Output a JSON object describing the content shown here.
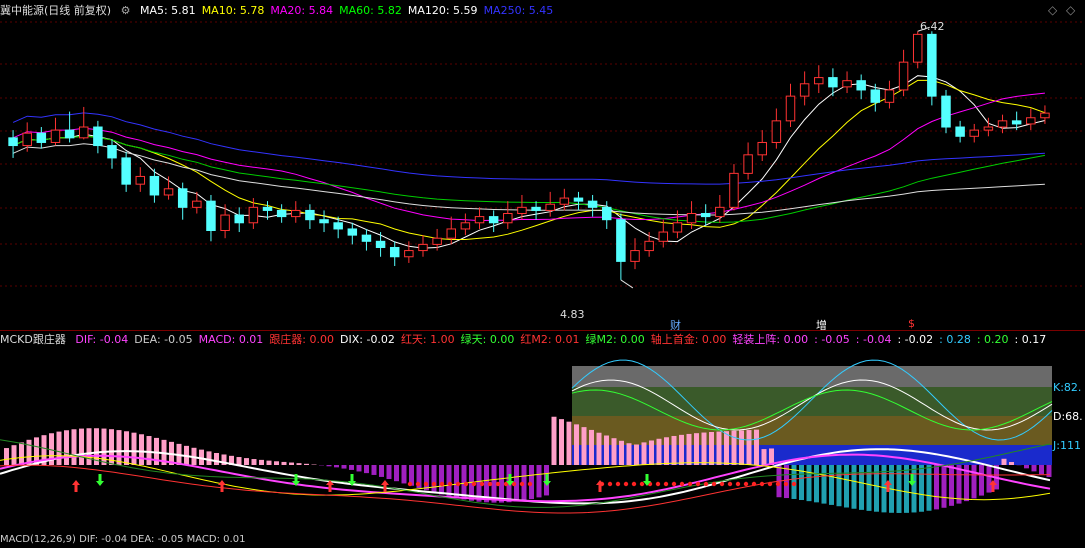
{
  "main_header": {
    "title": "冀中能源(日线 前复权)",
    "items": [
      {
        "label": "MA5: 5.81",
        "color": "#ffffff"
      },
      {
        "label": "MA10: 5.78",
        "color": "#ffff00"
      },
      {
        "label": "MA20: 5.84",
        "color": "#ff00ff"
      },
      {
        "label": "MA60: 5.82",
        "color": "#00ff00"
      },
      {
        "label": "MA120: 5.59",
        "color": "#ffffff"
      },
      {
        "label": "MA250: 5.45",
        "color": "#3333ff"
      }
    ]
  },
  "price_annotations": {
    "high": "6.42",
    "low": "4.83"
  },
  "event_markers": [
    {
      "label": "财",
      "color": "#66aaff"
    },
    {
      "label": "增",
      "color": "#ffffff"
    },
    {
      "label": "$",
      "color": "#ff3333"
    }
  ],
  "indicator_header": {
    "title": "MCKD跟庄器",
    "items": [
      {
        "label": "DIF: -0.04",
        "color": "#ff44ff"
      },
      {
        "label": "DEA: -0.05",
        "color": "#cccccc"
      },
      {
        "label": "MACD: 0.01",
        "color": "#ff44ff"
      },
      {
        "label": "跟庄器: 0.00",
        "color": "#ff3333"
      },
      {
        "label": "DIX: -0.02",
        "color": "#ffffff"
      },
      {
        "label": "红天: 1.00",
        "color": "#ff3333"
      },
      {
        "label": "绿天: 0.00",
        "color": "#33ff33"
      },
      {
        "label": "红M2: 0.01",
        "color": "#ff3333"
      },
      {
        "label": "绿M2: 0.00",
        "color": "#33ff33"
      },
      {
        "label": "轴上首金: 0.00",
        "color": "#ff3333"
      },
      {
        "label": "轻装上阵: 0.00",
        "color": "#ff44ff"
      },
      {
        "label": ": -0.05",
        "color": "#ff44ff"
      },
      {
        "label": ": -0.04",
        "color": "#ff44ff"
      },
      {
        "label": ": -0.02",
        "color": "#ffffff"
      },
      {
        "label": ": 0.28",
        "color": "#33ccff"
      },
      {
        "label": ": 0.20",
        "color": "#33ff33"
      },
      {
        "label": ": 0.17",
        "color": "#ffffff"
      }
    ]
  },
  "kdj_labels": {
    "k": "K:82.",
    "d": "D:68.",
    "j": "J:111"
  },
  "footer_header": {
    "label": "MACD(12,26,9) DIF: -0.04 DEA: -0.05 MACD: 0.01"
  },
  "chart_data": {
    "type": "candlestick",
    "candles": [
      [
        5.75,
        5.7,
        5.8,
        5.62
      ],
      [
        5.7,
        5.78,
        5.85,
        5.66
      ],
      [
        5.78,
        5.72,
        5.82,
        5.68
      ],
      [
        5.72,
        5.8,
        5.88,
        5.7
      ],
      [
        5.8,
        5.75,
        5.92,
        5.72
      ],
      [
        5.75,
        5.82,
        5.95,
        5.74
      ],
      [
        5.82,
        5.7,
        5.86,
        5.65
      ],
      [
        5.7,
        5.62,
        5.74,
        5.55
      ],
      [
        5.62,
        5.45,
        5.66,
        5.4
      ],
      [
        5.45,
        5.5,
        5.56,
        5.4
      ],
      [
        5.5,
        5.38,
        5.55,
        5.33
      ],
      [
        5.38,
        5.42,
        5.5,
        5.35
      ],
      [
        5.42,
        5.3,
        5.46,
        5.22
      ],
      [
        5.3,
        5.34,
        5.4,
        5.26
      ],
      [
        5.34,
        5.15,
        5.38,
        5.08
      ],
      [
        5.15,
        5.25,
        5.32,
        5.1
      ],
      [
        5.25,
        5.2,
        5.3,
        5.14
      ],
      [
        5.2,
        5.3,
        5.36,
        5.16
      ],
      [
        5.3,
        5.28,
        5.34,
        5.22
      ],
      [
        5.28,
        5.24,
        5.32,
        5.2
      ],
      [
        5.24,
        5.28,
        5.34,
        5.2
      ],
      [
        5.28,
        5.22,
        5.32,
        5.16
      ],
      [
        5.22,
        5.2,
        5.28,
        5.14
      ],
      [
        5.2,
        5.16,
        5.24,
        5.1
      ],
      [
        5.16,
        5.12,
        5.2,
        5.06
      ],
      [
        5.12,
        5.08,
        5.16,
        5.02
      ],
      [
        5.08,
        5.04,
        5.14,
        4.98
      ],
      [
        5.04,
        4.98,
        5.08,
        4.92
      ],
      [
        4.98,
        5.02,
        5.08,
        4.94
      ],
      [
        5.02,
        5.06,
        5.12,
        4.98
      ],
      [
        5.06,
        5.1,
        5.16,
        5.02
      ],
      [
        5.1,
        5.16,
        5.24,
        5.06
      ],
      [
        5.16,
        5.2,
        5.26,
        5.12
      ],
      [
        5.2,
        5.24,
        5.3,
        5.16
      ],
      [
        5.24,
        5.2,
        5.28,
        5.14
      ],
      [
        5.2,
        5.26,
        5.34,
        5.16
      ],
      [
        5.26,
        5.3,
        5.38,
        5.22
      ],
      [
        5.3,
        5.28,
        5.34,
        5.22
      ],
      [
        5.28,
        5.32,
        5.4,
        5.24
      ],
      [
        5.32,
        5.36,
        5.42,
        5.28
      ],
      [
        5.36,
        5.34,
        5.4,
        5.28
      ],
      [
        5.34,
        5.3,
        5.38,
        5.24
      ],
      [
        5.3,
        5.22,
        5.34,
        5.16
      ],
      [
        5.22,
        4.95,
        5.26,
        4.83
      ],
      [
        4.95,
        5.02,
        5.1,
        4.9
      ],
      [
        5.02,
        5.08,
        5.14,
        4.98
      ],
      [
        5.08,
        5.14,
        5.22,
        5.04
      ],
      [
        5.14,
        5.2,
        5.28,
        5.1
      ],
      [
        5.2,
        5.26,
        5.34,
        5.16
      ],
      [
        5.26,
        5.24,
        5.32,
        5.18
      ],
      [
        5.24,
        5.3,
        5.38,
        5.2
      ],
      [
        5.3,
        5.52,
        5.58,
        5.28
      ],
      [
        5.52,
        5.64,
        5.72,
        5.48
      ],
      [
        5.64,
        5.72,
        5.8,
        5.6
      ],
      [
        5.72,
        5.86,
        5.94,
        5.68
      ],
      [
        5.86,
        6.02,
        6.1,
        5.82
      ],
      [
        6.02,
        6.1,
        6.18,
        5.96
      ],
      [
        6.1,
        6.14,
        6.22,
        6.04
      ],
      [
        6.14,
        6.08,
        6.2,
        6.02
      ],
      [
        6.08,
        6.12,
        6.18,
        6.04
      ],
      [
        6.12,
        6.06,
        6.16,
        6.0
      ],
      [
        6.06,
        5.98,
        6.1,
        5.92
      ],
      [
        5.98,
        6.06,
        6.12,
        5.94
      ],
      [
        6.06,
        6.24,
        6.32,
        6.02
      ],
      [
        6.24,
        6.42,
        6.44,
        6.2
      ],
      [
        6.42,
        6.02,
        6.44,
        5.96
      ],
      [
        6.02,
        5.82,
        6.06,
        5.78
      ],
      [
        5.82,
        5.76,
        5.86,
        5.72
      ],
      [
        5.76,
        5.8,
        5.84,
        5.72
      ],
      [
        5.8,
        5.82,
        5.88,
        5.76
      ],
      [
        5.82,
        5.86,
        5.9,
        5.78
      ],
      [
        5.86,
        5.84,
        5.92,
        5.8
      ],
      [
        5.84,
        5.88,
        5.94,
        5.8
      ],
      [
        5.88,
        5.91,
        5.96,
        5.84
      ]
    ],
    "ylim": [
      4.7,
      6.5
    ],
    "series": [
      {
        "name": "MA5",
        "color": "#ffffff"
      },
      {
        "name": "MA10",
        "color": "#ffff00"
      },
      {
        "name": "MA20",
        "color": "#ff00ff"
      },
      {
        "name": "MA60",
        "color": "#00cc00"
      },
      {
        "name": "MA120",
        "color": "#dddddd"
      },
      {
        "name": "MA250",
        "color": "#3333ff"
      }
    ]
  }
}
